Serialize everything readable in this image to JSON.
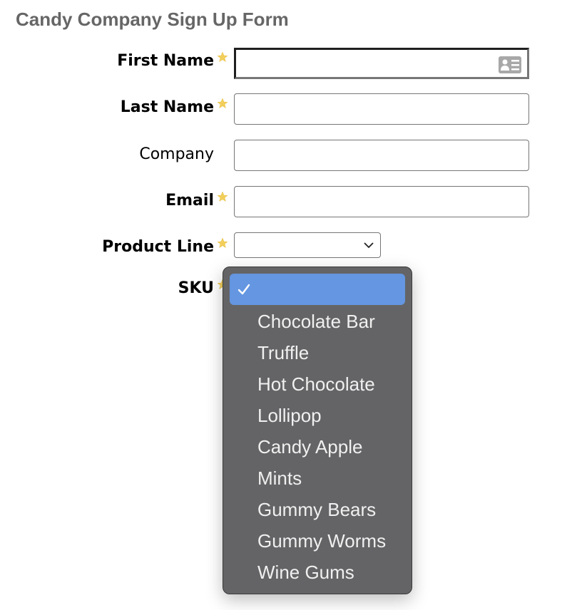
{
  "form": {
    "title": "Candy Company Sign Up Form",
    "fields": [
      {
        "label": "First Name",
        "required": true,
        "value": "",
        "focused": true
      },
      {
        "label": "Last Name",
        "required": true,
        "value": ""
      },
      {
        "label": "Company",
        "required": false,
        "value": ""
      },
      {
        "label": "Email",
        "required": true,
        "value": ""
      }
    ],
    "product_line": {
      "label": "Product Line",
      "required": true,
      "value": ""
    },
    "sku": {
      "label": "SKU",
      "required": true,
      "value": ""
    }
  },
  "sku_dropdown": {
    "selected_index": 0,
    "options": [
      "",
      "Chocolate Bar",
      "Truffle",
      "Hot Chocolate",
      "Lollipop",
      "Candy Apple",
      "Mints",
      "Gummy Bears",
      "Gummy Worms",
      "Wine Gums"
    ]
  },
  "icons": {
    "required": "star-icon",
    "autofill": "contact-card-icon",
    "select": "chevron-down-icon",
    "selected": "checkmark-icon"
  },
  "colors": {
    "title": "#666666",
    "star": "#f2cf5b",
    "highlight": "#6496e1",
    "dropdown_bg": "#646466"
  }
}
